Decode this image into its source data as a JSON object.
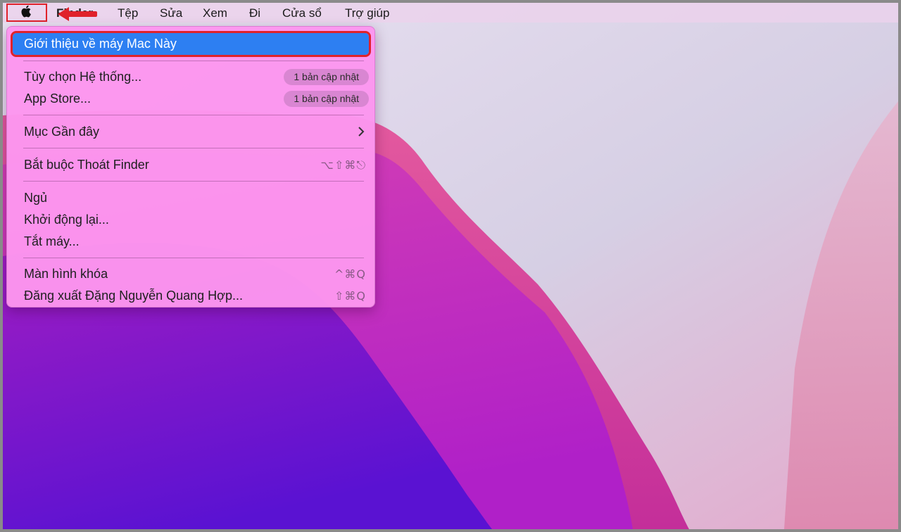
{
  "menubar": {
    "apple_icon": "apple-logo-icon",
    "items": [
      "Finder",
      "Tệp",
      "Sửa",
      "Xem",
      "Đi",
      "Cửa sổ",
      "Trợ giúp"
    ]
  },
  "apple_menu": {
    "about": "Giới thiệu về máy Mac Này",
    "system_prefs": "Tùy chọn Hệ thống...",
    "system_prefs_badge": "1 bản cập nhật",
    "app_store": "App Store...",
    "app_store_badge": "1 bản cập nhật",
    "recent_items": "Mục Gần đây",
    "force_quit": "Bắt buộc Thoát Finder",
    "force_quit_shortcut": "⌥⇧⌘⎋",
    "sleep": "Ngủ",
    "restart": "Khởi động lại...",
    "shutdown": "Tắt máy...",
    "lock_screen": "Màn hình khóa",
    "lock_screen_shortcut": "^⌘Q",
    "logout": "Đăng xuất Đặng Nguyễn Quang Hợp...",
    "logout_shortcut": "⇧⌘Q"
  },
  "colors": {
    "highlight": "#2d7ff2",
    "annotation_red": "#e0222b",
    "menu_bg": "#fc96ee"
  }
}
